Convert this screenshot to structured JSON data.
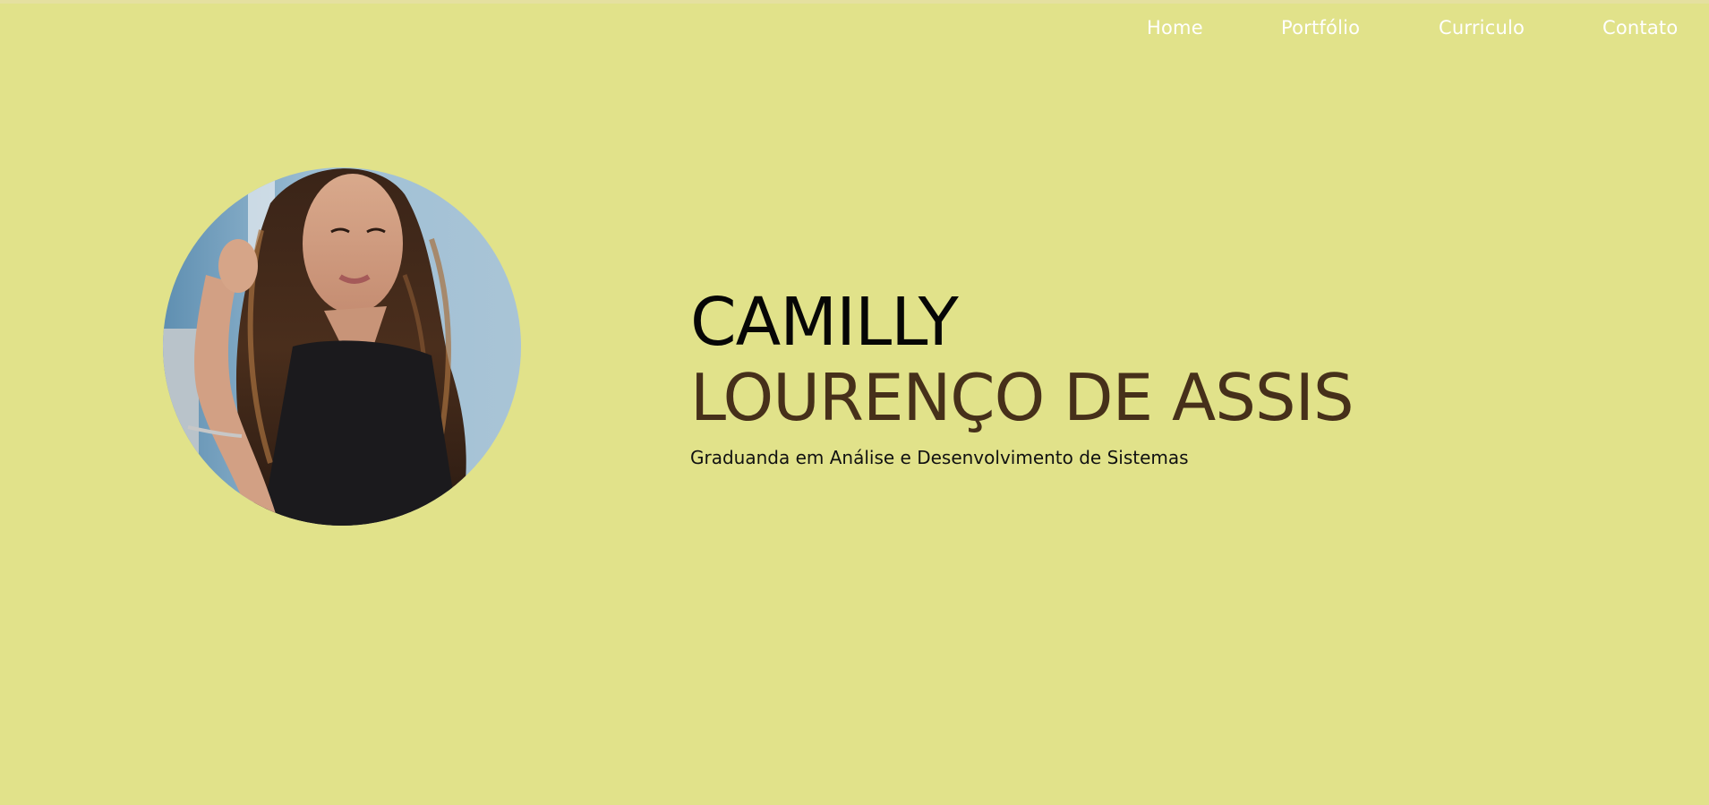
{
  "theme": {
    "background": "#e1e28a",
    "nav_text": "#ffffff",
    "first_name_color": "#060606",
    "last_name_color": "#46301a",
    "subtitle_color": "#111111"
  },
  "nav": {
    "items": [
      {
        "label": "Home"
      },
      {
        "label": "Portfólio"
      },
      {
        "label": "Curriculo"
      },
      {
        "label": "Contato"
      }
    ]
  },
  "hero": {
    "first_name": "CAMILLY",
    "last_name": "LOURENÇO DE ASSIS",
    "subtitle": "Graduanda em Análise e Desenvolvimento de Sistemas",
    "photo_icon": "profile-photo"
  }
}
